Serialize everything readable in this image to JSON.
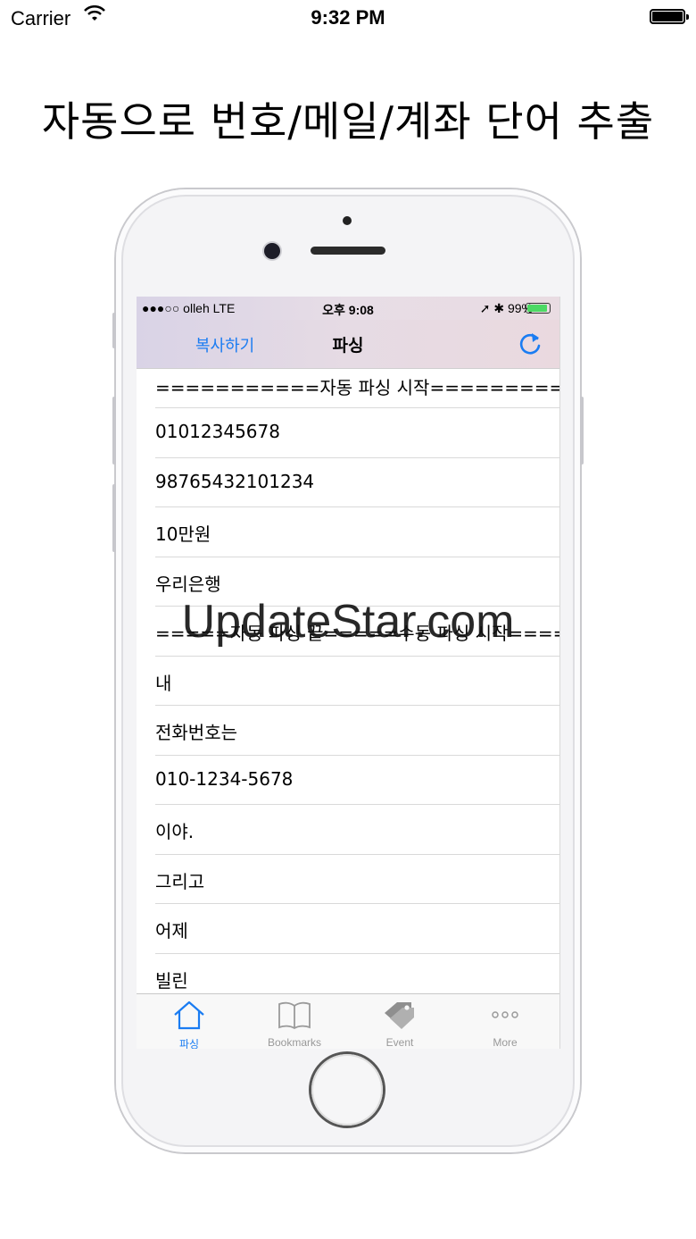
{
  "outer_status": {
    "carrier": "Carrier",
    "time": "9:32 PM"
  },
  "headline": "자동으로 번호/메일/계좌 단어 추출",
  "inner_status": {
    "carrier": "●●●○○ olleh  LTE",
    "time": "오후 9:08",
    "right": "➚ ✱ 99%"
  },
  "navbar": {
    "left_button": "복사하기",
    "title": "파싱",
    "refresh_icon": "refresh-icon"
  },
  "rows": [
    "===========자동 파싱 시작===========",
    "01012345678",
    "98765432101234",
    "10만원",
    "우리은행",
    "=====자동 파싱 끝=====수동 파싱 시작=====",
    "내",
    "전화번호는",
    "010-1234-5678",
    "이야.",
    "그리고",
    "어제",
    "빌린"
  ],
  "tabs": [
    {
      "label": "파싱",
      "icon": "home-icon",
      "active": true
    },
    {
      "label": "Bookmarks",
      "icon": "book-icon",
      "active": false
    },
    {
      "label": "Event",
      "icon": "tag-icon",
      "active": false
    },
    {
      "label": "More",
      "icon": "more-icon",
      "active": false
    }
  ],
  "watermark": "UpdateStar.com",
  "colors": {
    "accent": "#1a7cf2",
    "tab_inactive": "#999999",
    "battery_green": "#4cd964"
  }
}
